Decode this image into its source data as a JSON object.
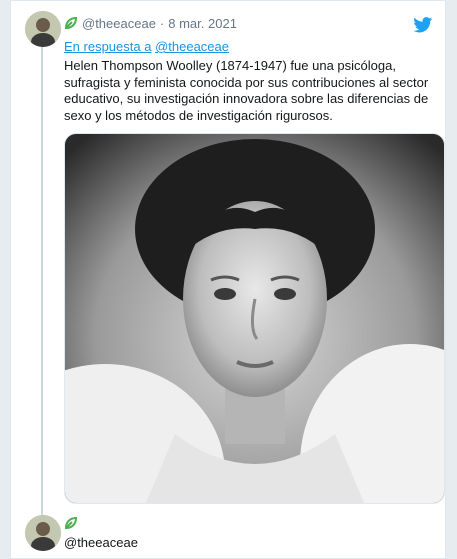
{
  "tweet": {
    "handle": "@theeaceae",
    "date": "8 mar. 2021",
    "reply_prefix": "En respuesta a",
    "reply_handle": "@theeaceae",
    "text": "Helen Thompson Woolley (1874-1947) fue una psicóloga, sufragista y feminista conocida por sus contribuciones al sector educativo, su investigación innovadora sobre las diferencias de sexo y los métodos de investigación rigurosos."
  },
  "next_reply": {
    "handle": "@theeaceae"
  },
  "colors": {
    "link_blue": "#1b95e0",
    "twitter_blue": "#1da1f2",
    "brand_green": "#4caf50",
    "muted_gray": "#657786"
  },
  "icons": [
    "twitter-bird-icon",
    "brand-leaf-icon",
    "avatar"
  ]
}
